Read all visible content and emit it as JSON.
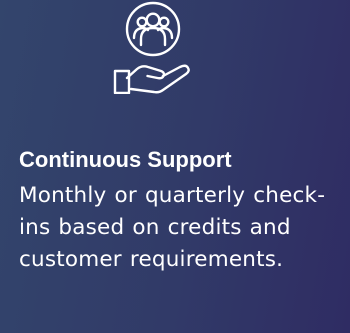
{
  "card": {
    "icon": "hand-holding-people-icon",
    "title": "Continuous Support",
    "description": "Monthly or quarterly check-ins based on credits and customer requirements."
  },
  "colors": {
    "background_start": "#33456c",
    "background_end": "#2f2c63",
    "text": "#ffffff"
  }
}
